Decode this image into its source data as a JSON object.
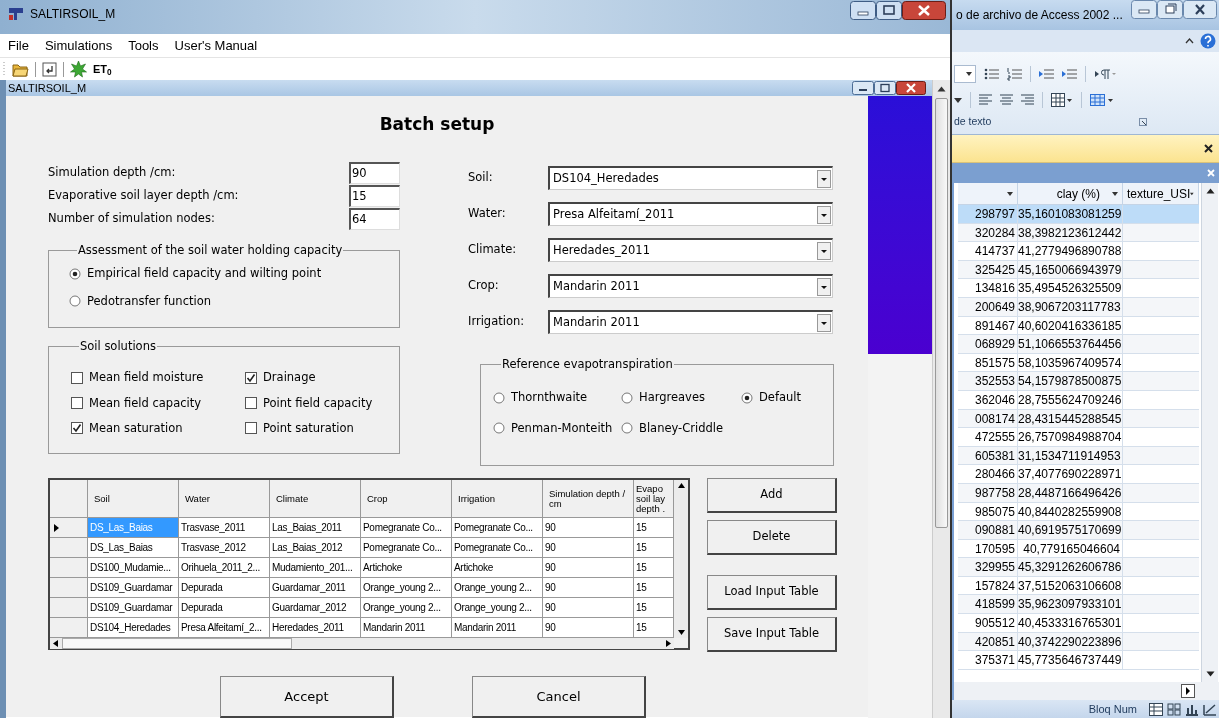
{
  "main_window": {
    "title": "SALTIRSOIL_M"
  },
  "menu": [
    "File",
    "Simulations",
    "Tools",
    "User's Manual"
  ],
  "toolbar": {
    "et_label": "ET$_{0}$"
  },
  "child_window": {
    "title": "SALTIRSOIL_M"
  },
  "dialog": {
    "title": "Batch setup",
    "fields": [
      {
        "label": "Simulation depth /cm:",
        "value": "90"
      },
      {
        "label": "Evaporative soil layer depth /cm:",
        "value": "15"
      },
      {
        "label": "Number of simulation nodes:",
        "value": "64"
      }
    ],
    "water_capacity": {
      "title": "Assessment of the soil water holding capacity",
      "options": [
        {
          "label": "Empirical field capacity and wilting point",
          "selected": true
        },
        {
          "label": "Pedotransfer function",
          "selected": false
        }
      ]
    },
    "soil_solutions": {
      "title": "Soil solutions",
      "options": [
        {
          "label": "Mean field moisture",
          "checked": false
        },
        {
          "label": "Drainage",
          "checked": true
        },
        {
          "label": "Mean field capacity",
          "checked": false
        },
        {
          "label": "Point field capacity",
          "checked": false
        },
        {
          "label": "Mean saturation",
          "checked": true
        },
        {
          "label": "Point saturation",
          "checked": false
        }
      ]
    },
    "selectors": [
      {
        "label": "Soil:",
        "value": "DS104_Heredades"
      },
      {
        "label": "Water:",
        "value": "Presa Alfeitamí_2011"
      },
      {
        "label": "Climate:",
        "value": "Heredades_2011"
      },
      {
        "label": "Crop:",
        "value": "Mandarin 2011"
      },
      {
        "label": "Irrigation:",
        "value": "Mandarin 2011"
      }
    ],
    "reference_et": {
      "title": "Reference evapotranspiration",
      "options": [
        {
          "label": "Thornthwaite",
          "selected": false
        },
        {
          "label": "Hargreaves",
          "selected": false
        },
        {
          "label": "Default",
          "selected": true
        },
        {
          "label": "Penman-Monteith",
          "selected": false
        },
        {
          "label": "Blaney-Criddle",
          "selected": false
        }
      ]
    },
    "table": {
      "columns": [
        "Soil",
        "Water",
        "Climate",
        "Crop",
        "Irrigation",
        "Simulation depth / cm",
        "Evapo soil lay depth ."
      ],
      "rows": [
        {
          "selected": true,
          "cells": [
            "DS_Las_Baias",
            "Trasvase_2011",
            "Las_Baias_2011",
            "Pomegranate Co...",
            "Pomegranate Co...",
            "90",
            "15"
          ]
        },
        {
          "selected": false,
          "cells": [
            "DS_Las_Baias",
            "Trasvase_2012",
            "Las_Baias_2012",
            "Pomegranate Co...",
            "Pomegranate Co...",
            "90",
            "15"
          ]
        },
        {
          "selected": false,
          "cells": [
            "DS100_Mudamie...",
            "Orihuela_2011_2...",
            "Mudamiento_201...",
            "Artichoke",
            "Artichoke",
            "90",
            "15"
          ]
        },
        {
          "selected": false,
          "cells": [
            "DS109_Guardamar",
            "Depurada",
            "Guardamar_2011",
            "Orange_young 2...",
            "Orange_young 2...",
            "90",
            "15"
          ]
        },
        {
          "selected": false,
          "cells": [
            "DS109_Guardamar",
            "Depurada",
            "Guardamar_2012",
            "Orange_young 2...",
            "Orange_young 2...",
            "90",
            "15"
          ]
        },
        {
          "selected": false,
          "cells": [
            "DS104_Heredades",
            "Presa Alfeitamí_2...",
            "Heredades_2011",
            "Mandarin 2011",
            "Mandarin 2011",
            "90",
            "15"
          ]
        }
      ]
    },
    "side_buttons": [
      "Add",
      "Delete",
      "Load Input Table",
      "Save Input Table"
    ],
    "buttons": [
      "Accept",
      "Cancel"
    ]
  },
  "access_window": {
    "title": "o de archivo de Access 2002 ...",
    "ribbon_group": "de texto",
    "table": {
      "columns": [
        "",
        "clay (%)",
        "texture_USI"
      ],
      "rows": [
        {
          "selected": true,
          "cells": [
            "298797",
            "35,1601083081259"
          ]
        },
        {
          "selected": false,
          "cells": [
            "320284",
            "38,3982123612442"
          ]
        },
        {
          "selected": false,
          "cells": [
            "414737",
            "41,2779496890788"
          ]
        },
        {
          "selected": false,
          "cells": [
            "325425",
            "45,1650066943979"
          ]
        },
        {
          "selected": false,
          "cells": [
            "134816",
            "35,4954526325509"
          ]
        },
        {
          "selected": false,
          "cells": [
            "200649",
            "38,9067203117783"
          ]
        },
        {
          "selected": false,
          "cells": [
            "891467",
            "40,6020416336185"
          ]
        },
        {
          "selected": false,
          "cells": [
            "068929",
            "51,1066553764456"
          ]
        },
        {
          "selected": false,
          "cells": [
            "851575",
            "58,1035967409574"
          ]
        },
        {
          "selected": false,
          "cells": [
            "352553",
            "54,1579878500875"
          ]
        },
        {
          "selected": false,
          "cells": [
            "362046",
            "28,7555624709246"
          ]
        },
        {
          "selected": false,
          "cells": [
            "008174",
            "28,4315445288545"
          ]
        },
        {
          "selected": false,
          "cells": [
            "472555",
            "26,7570984988704"
          ]
        },
        {
          "selected": false,
          "cells": [
            "605381",
            "31,1534711914953"
          ]
        },
        {
          "selected": false,
          "cells": [
            "280466",
            "37,4077690228971"
          ]
        },
        {
          "selected": false,
          "cells": [
            "987758",
            "28,4487166496426"
          ]
        },
        {
          "selected": false,
          "cells": [
            "985075",
            "40,8440282559908"
          ]
        },
        {
          "selected": false,
          "cells": [
            "090881",
            "40,6919575170699"
          ]
        },
        {
          "selected": false,
          "cells": [
            "170595",
            "40,779165046604"
          ]
        },
        {
          "selected": false,
          "cells": [
            "329955",
            "45,3291262606786"
          ]
        },
        {
          "selected": false,
          "cells": [
            "157824",
            "37,5152063106608"
          ]
        },
        {
          "selected": false,
          "cells": [
            "418599",
            "35,9623097933101"
          ]
        },
        {
          "selected": false,
          "cells": [
            "905512",
            "40,4533316765301"
          ]
        },
        {
          "selected": false,
          "cells": [
            "420851",
            "40,3742290223896"
          ]
        },
        {
          "selected": false,
          "cells": [
            "375371",
            "45,7735646737449"
          ]
        }
      ]
    },
    "status": "Bloq Num"
  }
}
